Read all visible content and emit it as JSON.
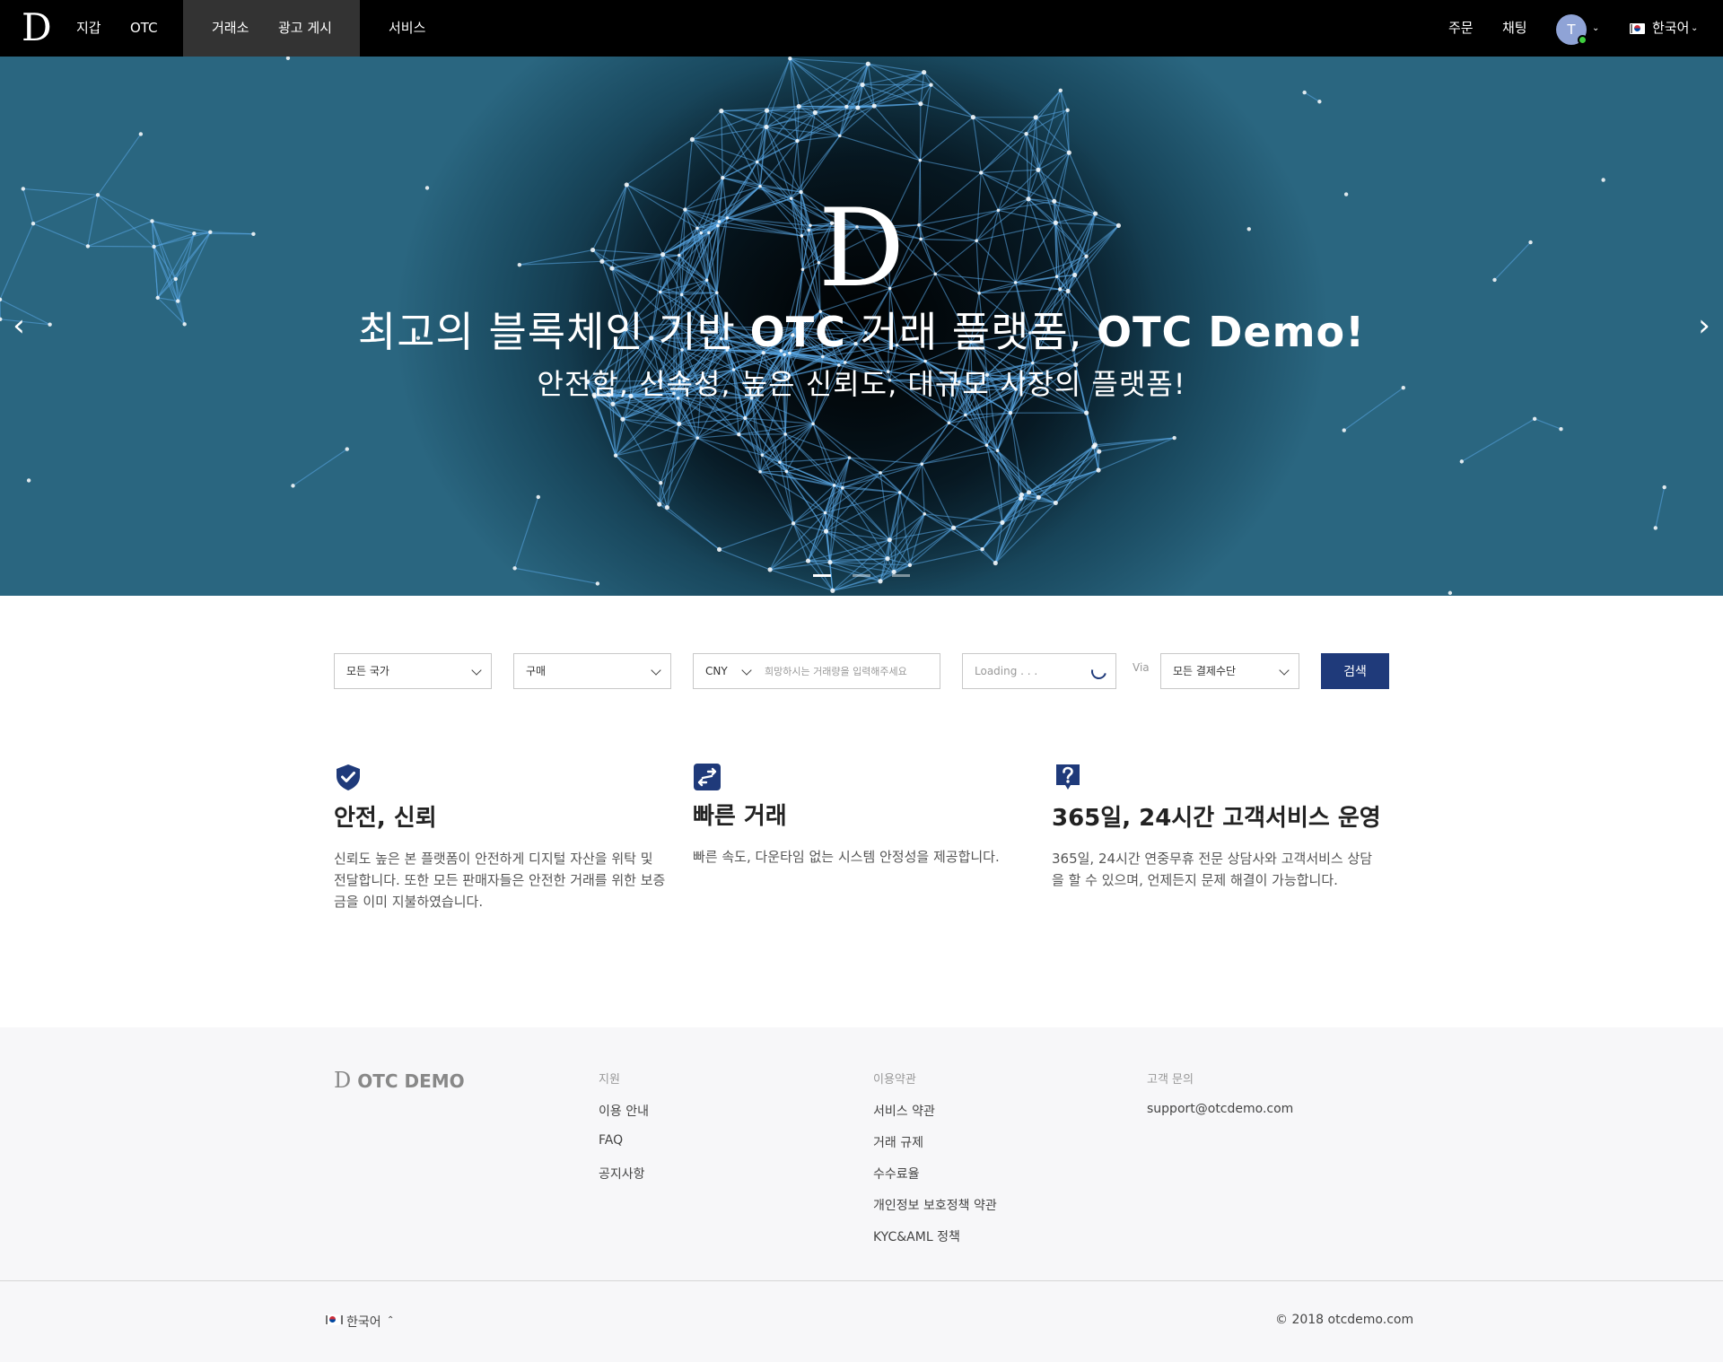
{
  "nav": {
    "logo": "D",
    "wallet": "지갑",
    "otc": "OTC",
    "exchange": "거래소",
    "post_ad": "광고 게시",
    "services": "서비스",
    "orders": "주문",
    "chat": "채팅",
    "avatar_initial": "T",
    "language": "한국어"
  },
  "hero": {
    "logo": "D",
    "title_part1": "최고의 블록체인 기반 ",
    "title_bold1": "OTC",
    "title_part2": " 거래 플랫폼, ",
    "title_bold2": "OTC Demo!",
    "subtitle": "안전함, 신속성, 높은 신뢰도, 대규모 시장의 플랫폼!",
    "prev_icon": "‹",
    "next_icon": "›",
    "active_slide": 1,
    "slide_count": 3
  },
  "search": {
    "country": "모든 국가",
    "trade_type": "구매",
    "currency": "CNY",
    "amount_placeholder": "희망하시는 거래량을 입력해주세요",
    "loading": "Loading . . .",
    "via": "Via",
    "payment": "모든 결제수단",
    "button": "검색"
  },
  "features": [
    {
      "icon": "shield-check-icon",
      "title": "안전, 신뢰",
      "desc": "신뢰도 높은 본 플랫폼이 안전하게 디지털 자산을 위탁 및 전달합니다. 또한 모든 판매자들은 안전한 거래를 위한 보증금을 이미 지불하였습니다."
    },
    {
      "icon": "exchange-arrows-icon",
      "title": "빠른 거래",
      "desc": "빠른 속도, 다운타임 없는 시스템 안정성을 제공합니다."
    },
    {
      "icon": "question-bubble-icon",
      "title": "365일, 24시간 고객서비스 운영",
      "desc": "365일, 24시간 연중무휴 전문 상담사와 고객서비스 상담을 할 수 있으며, 언제든지 문제 해결이 가능합니다."
    }
  ],
  "footer": {
    "logo_d": "D",
    "logo_text": "OTC DEMO",
    "support": {
      "heading": "지원",
      "links": [
        "이용 안내",
        "FAQ",
        "공지사항"
      ]
    },
    "terms": {
      "heading": "이용약관",
      "links": [
        "서비스 약관",
        "거래 규제",
        "수수료율",
        "개인정보 보호정책 약관",
        "KYC&AML 정책"
      ]
    },
    "contact": {
      "heading": "고객 문의",
      "email": "support@otcdemo.com"
    },
    "language": "한국어",
    "copyright": "© 2018 otcdemo.com"
  },
  "colors": {
    "primary": "#1f3a7a",
    "nav_bg": "#000000",
    "footer_bg": "#f7f7f9"
  }
}
